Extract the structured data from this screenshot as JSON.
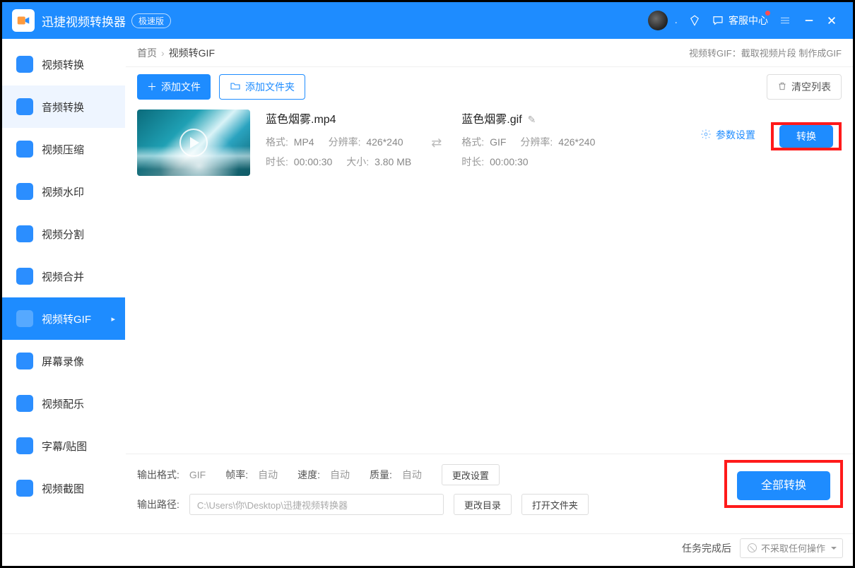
{
  "titlebar": {
    "app_name": "迅捷视频转换器",
    "edition": "极速版",
    "support_label": "客服中心"
  },
  "sidebar": {
    "items": [
      {
        "label": "视频转换"
      },
      {
        "label": "音频转换"
      },
      {
        "label": "视频压缩"
      },
      {
        "label": "视频水印"
      },
      {
        "label": "视频分割"
      },
      {
        "label": "视频合并"
      },
      {
        "label": "视频转GIF"
      },
      {
        "label": "屏幕录像"
      },
      {
        "label": "视频配乐"
      },
      {
        "label": "字幕/贴图"
      },
      {
        "label": "视频截图"
      }
    ]
  },
  "breadcrumb": {
    "home": "首页",
    "current": "视频转GIF",
    "desc": "视频转GIF：截取视频片段 制作成GIF"
  },
  "toolbar": {
    "add_file": "添加文件",
    "add_folder": "添加文件夹",
    "clear_list": "清空列表"
  },
  "file": {
    "src": {
      "name": "蓝色烟雾.mp4",
      "format_lab": "格式:",
      "format": "MP4",
      "res_lab": "分辨率:",
      "res": "426*240",
      "dur_lab": "时长:",
      "dur": "00:00:30",
      "size_lab": "大小:",
      "size": "3.80 MB"
    },
    "dst": {
      "name": "蓝色烟雾.gif",
      "format_lab": "格式:",
      "format": "GIF",
      "res_lab": "分辨率:",
      "res": "426*240",
      "dur_lab": "时长:",
      "dur": "00:00:30"
    },
    "param_link": "参数设置",
    "convert_btn": "转换"
  },
  "bottom": {
    "out_format_lab": "输出格式:",
    "out_format": "GIF",
    "fps_lab": "帧率:",
    "fps": "自动",
    "speed_lab": "速度:",
    "speed": "自动",
    "quality_lab": "质量:",
    "quality": "自动",
    "change_settings": "更改设置",
    "out_path_lab": "输出路径:",
    "out_path": "C:\\Users\\你\\Desktop\\迅捷视频转换器",
    "change_dir": "更改目录",
    "open_folder": "打开文件夹",
    "convert_all": "全部转换"
  },
  "status": {
    "after_label": "任务完成后",
    "action": "不采取任何操作"
  }
}
